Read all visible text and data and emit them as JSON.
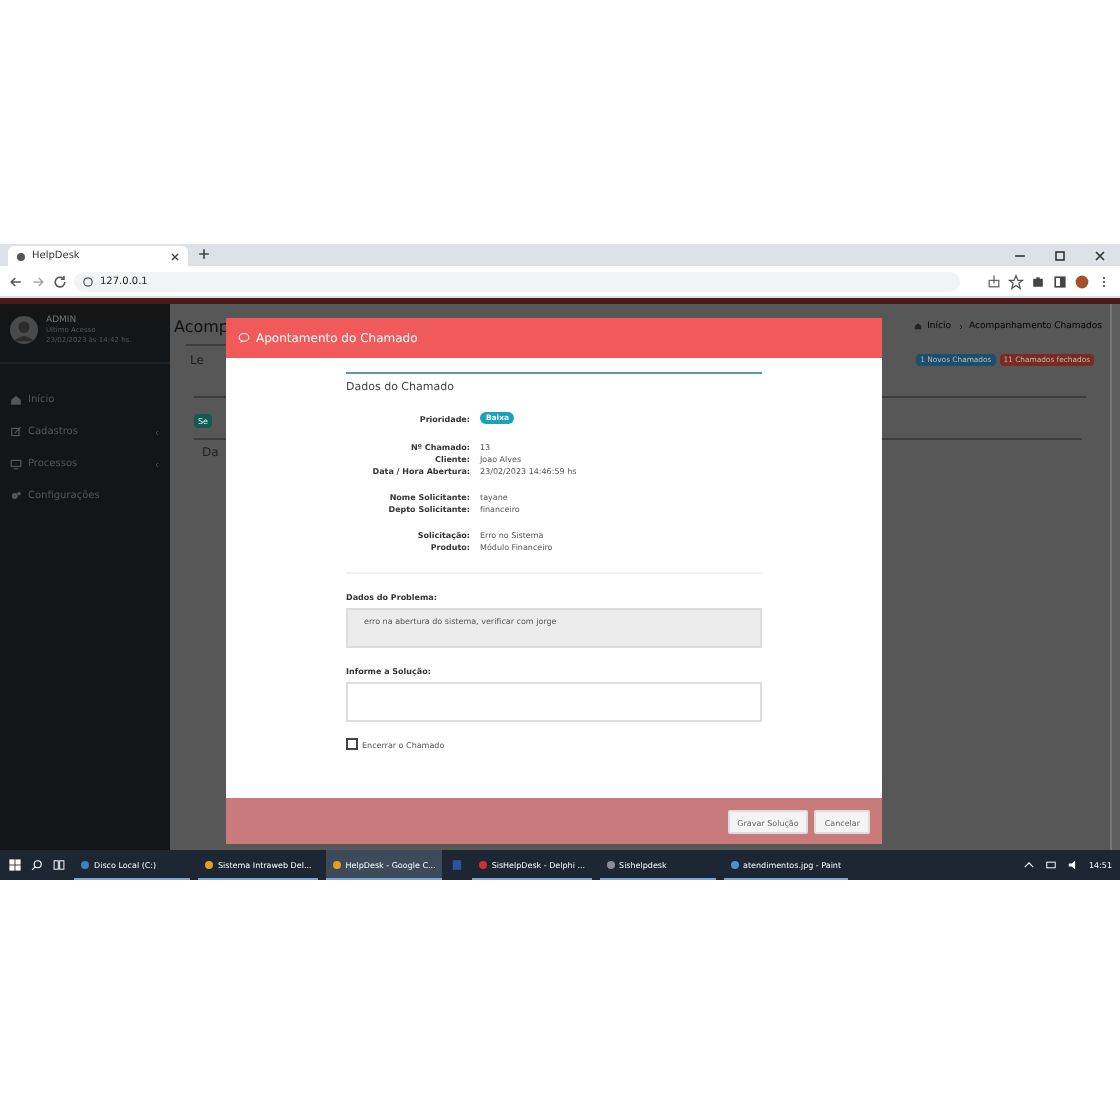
{
  "browser": {
    "tab_title": "HelpDesk",
    "url": "127.0.0.1"
  },
  "sidebar": {
    "user_name": "ADMIN",
    "last_access_label": "Último Acesso",
    "last_access": "23/02/2023 às 14:42 hs.",
    "items": [
      {
        "label": "Início",
        "expandable": false
      },
      {
        "label": "Cadastros",
        "expandable": true
      },
      {
        "label": "Processos",
        "expandable": true
      },
      {
        "label": "Configurações",
        "expandable": false
      }
    ]
  },
  "page": {
    "title": "Acomp",
    "tab_label": "Le",
    "badge_fragment": "Se",
    "section_label": "Da",
    "breadcrumb": [
      "Início",
      "Acompanhamento Chamados"
    ],
    "badges": [
      {
        "label": "1 Novos Chamados",
        "color": "#1d4e6e"
      },
      {
        "label": "11 Chamados fechados",
        "color": "#7a2a22"
      }
    ]
  },
  "modal": {
    "title": "Apontamento do Chamado",
    "section_title": "Dados do Chamado",
    "priority_label": "Prioridade:",
    "priority": "Baixa",
    "field_groups": [
      [
        {
          "label": "Nº Chamado:",
          "value": "13"
        },
        {
          "label": "Cliente:",
          "value": "Joao Alves"
        },
        {
          "label": "Data / Hora Abertura:",
          "value": "23/02/2023 14:46:59 hs"
        }
      ],
      [
        {
          "label": "Nome Solicitante:",
          "value": "tayane"
        },
        {
          "label": "Depto Solicitante:",
          "value": "financeiro"
        }
      ],
      [
        {
          "label": "Solicitação:",
          "value": "Erro no Sistema"
        },
        {
          "label": "Produto:",
          "value": "Módulo Financeiro"
        }
      ]
    ],
    "problem_label": "Dados do Problema:",
    "problem_value": "erro na abertura do sistema, verificar com jorge",
    "solution_label": "Informe a Solução:",
    "close_checkbox": {
      "label": "Encerrar o Chamado",
      "checked": false
    },
    "buttons": [
      "Gravar Solução",
      "Cancelar"
    ]
  },
  "taskbar": {
    "items": [
      {
        "label": "Disco Local (C:)",
        "selected": false
      },
      {
        "label": "Sistema Intraweb Del...",
        "selected": false
      },
      {
        "label": "HelpDesk - Google C...",
        "selected": true
      },
      {
        "label": "SisHelpDesk - Delphi ...",
        "selected": false
      },
      {
        "label": "Sishelpdesk",
        "selected": false
      },
      {
        "label": "atendimentos.jpg - Paint",
        "selected": false
      }
    ],
    "clock": "14:51"
  }
}
